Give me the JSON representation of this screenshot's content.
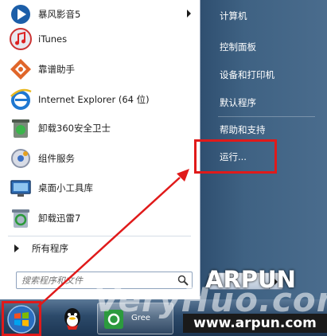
{
  "programs": [
    {
      "label": "暴风影音5",
      "icon": "storm-player-icon",
      "submenu": true
    },
    {
      "label": "iTunes",
      "icon": "itunes-icon",
      "submenu": false
    },
    {
      "label": "靠谱助手",
      "icon": "kaopu-helper-icon",
      "submenu": false
    },
    {
      "label": "Internet Explorer (64 位)",
      "icon": "internet-explorer-icon",
      "submenu": false
    },
    {
      "label": "卸载360安全卫士",
      "icon": "uninstall-360-icon",
      "submenu": false
    },
    {
      "label": "组件服务",
      "icon": "component-services-icon",
      "submenu": false
    },
    {
      "label": "桌面小工具库",
      "icon": "desktop-gadgets-icon",
      "submenu": false
    },
    {
      "label": "卸载迅雷7",
      "icon": "uninstall-xunlei-icon",
      "submenu": false
    }
  ],
  "all_programs": "所有程序",
  "search": {
    "placeholder": "搜索程序和文件"
  },
  "right_menu": {
    "computer": "计算机",
    "control_panel": "控制面板",
    "devices_printers": "设备和打印机",
    "default_programs": "默认程序",
    "help_support": "帮助和支持",
    "run": "运行..."
  },
  "taskbar": {
    "app_label": "Gree"
  },
  "watermarks": {
    "verypc": "VeryHuo.com",
    "arpun": "ARPUN",
    "url": "www.arpun.com"
  },
  "colors": {
    "highlight": "#e01a1a",
    "arrow": "#e01a1a"
  }
}
